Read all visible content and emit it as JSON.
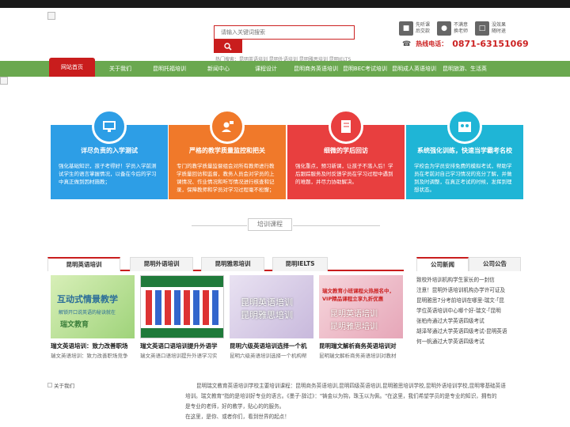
{
  "header": {
    "search_placeholder": "请输入关键词搜索",
    "hot_search": "热门搜索：昆明英语培训 昆明外语培训 昆明雅思培训 昆明IELTS",
    "promos": [
      {
        "icon": "teacher-icon",
        "line1": "先听课",
        "line2": "后交款"
      },
      {
        "icon": "people-icon",
        "line1": "不满意",
        "line2": "换老师"
      },
      {
        "icon": "refund-icon",
        "line1": "没效果",
        "line2": "随时退"
      }
    ],
    "phone_label": "热线电话：",
    "phone_number": "0871-63151069"
  },
  "nav": {
    "items": [
      "网站首页",
      "关于我们",
      "昆明托福培训",
      "新闻中心",
      "课程设计",
      "昆明商务英语培训",
      "昆明BEC考试培训",
      "昆明成人英语培训",
      "昆明旅游、生活英"
    ]
  },
  "features": [
    {
      "color": "#2d9ee6",
      "icon": "monitor-icon",
      "title": "详尽负责的入学测试",
      "desc": "强化基础知识，孩子考得好！学员入学前测试学生的语言掌握情况，以备在今后的学习中真正做到因材施教；"
    },
    {
      "color": "#f0792a",
      "icon": "person-speech-icon",
      "title": "严格的教学质量监控和把关",
      "desc": "专门的教学质量监督组会对所有教师进行教学质量回访和监督，教务人员会对学员的上课情况、作业情况和听写情况进行核查和记录，保障教师和学员对学习过程毫不松懈；"
    },
    {
      "color": "#e83f3f",
      "icon": "book-icon",
      "title": "细微的学后回访",
      "desc": "强化重点，预习新课，让孩子不落人后！学后跟踪服务及时反馈学员在学习过程中遇到的难题，并尽力协助解决。"
    },
    {
      "color": "#1fb5d6",
      "icon": "group-icon",
      "title": "系统强化训练，快速当学霸考名校",
      "desc": "学校会为学员安排免费的模拟考试，帮助学员在考前对自己学习情况的充分了解，并做到及时调整，在真正考试的时候，发挥到理想状态。"
    }
  ],
  "section": {
    "title": "培训课程"
  },
  "course_tabs": [
    "昆明英语培训",
    "昆明外语培训",
    "昆明雅思培训",
    "昆明IELTS"
  ],
  "courses": [
    {
      "img_text_1": "互动式情景教学",
      "img_text_2": "解锁开口说英语的秘诀就在",
      "img_text_3": "瑞文教育",
      "title": "瑞文英语培训：致力改善职场",
      "desc": "瑞文英语培训：致力改善职场竞争"
    },
    {
      "title": "瑞文英语口语培训提升外语学",
      "desc": "瑞文英语口语培训提升外语学习实"
    },
    {
      "img_text_1": "昆明英语培训",
      "img_text_2": "昆明雅思培训",
      "title": "昆明六级英语培训选择一个机",
      "desc": "昆明六级英语培训选择一个机构帮"
    },
    {
      "img_text_1": "瑞文教育小班课程火热报名中，",
      "img_text_2": "VIP精品课程立享九折优惠",
      "img_text_3": "昆明英语培训",
      "img_text_4": "昆明雅思培训",
      "title": "昆明瑞文解析商务英语培训对",
      "desc": "昆明瑞文解析商务英语培训对教材"
    }
  ],
  "news_tabs": [
    "公司新闻",
    "公司公告"
  ],
  "news": [
    "致校外培训机构学生家长的一封信",
    "注意！昆明外语培训机构办学许可证及",
    "昆明雅思7分考前培训在哪里-瑞文·「昆",
    "学位英语培训中心哪个好-瑞文·「昆明",
    "张柏舟通过大学英语四级考试",
    "胡泽琴通过大学英语四级考试-昆明英语",
    "何一帆通过大学英语四级考试"
  ],
  "about": {
    "img_alt": "关于我们",
    "line1": "昆明瑞文教育英语培训学校主要培训课程：昆明商务英语培训,昆明四级英语培训,昆明雅思培训学校,昆明外语培训学校,昆明零基础英语",
    "line2": "培训。瑞文教育\"指的是培训好专业的语言。《墨子·辞过》：\"铸金以为钩，珠玉以为佩。\"在这里，我们希望学员的是专业的知识，拥有的",
    "line3": "是专业的老师，好的教学，贴心的的服务。",
    "line4": "在这里，是你、或者你们，看到世界的起点！"
  }
}
